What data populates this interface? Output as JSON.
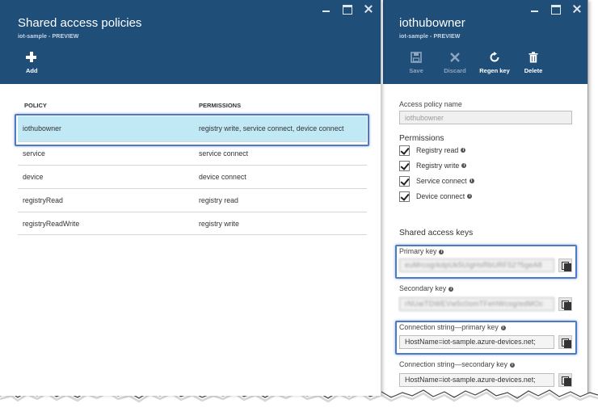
{
  "left_blade": {
    "title": "Shared access policies",
    "subtitle": "iot-sample - PREVIEW",
    "commands": {
      "add_label": "Add"
    },
    "table": {
      "headers": [
        "POLICY",
        "PERMISSIONS"
      ],
      "rows": [
        {
          "policy": "iothubowner",
          "permissions": "registry write, service connect, device connect"
        },
        {
          "policy": "service",
          "permissions": "service connect"
        },
        {
          "policy": "device",
          "permissions": "device connect"
        },
        {
          "policy": "registryRead",
          "permissions": "registry read"
        },
        {
          "policy": "registryReadWrite",
          "permissions": "registry write"
        }
      ]
    }
  },
  "right_blade": {
    "title": "iothubowner",
    "subtitle": "iot-sample - PREVIEW",
    "commands": {
      "save_label": "Save",
      "discard_label": "Discard",
      "regen_label": "Regen key",
      "delete_label": "Delete"
    },
    "policy_name_label": "Access policy name",
    "policy_name_value": "iothubowner",
    "permissions_label": "Permissions",
    "permissions": [
      "Registry read",
      "Registry write",
      "Service connect",
      "Device connect"
    ],
    "keys_label": "Shared access keys",
    "primary_key_label": "Primary key",
    "primary_key_value": "euMrcogrkdpUk5UigHsRbURF52?5geA8",
    "secondary_key_label": "Secondary key",
    "secondary_key_value": "rNUaiTDWEVw5c0omTFeHWcog/edMOc",
    "conn_primary_label": "Connection string—primary key",
    "conn_primary_value": "HostName=iot-sample.azure-devices.net;",
    "conn_secondary_label": "Connection string—secondary key",
    "conn_secondary_value": "HostName=iot-sample.azure-devices.net;"
  },
  "colors": {
    "header_bg": "#1f4e79",
    "selected_row_bg": "#c0e8f5",
    "callout_border": "#4a7ac8"
  }
}
